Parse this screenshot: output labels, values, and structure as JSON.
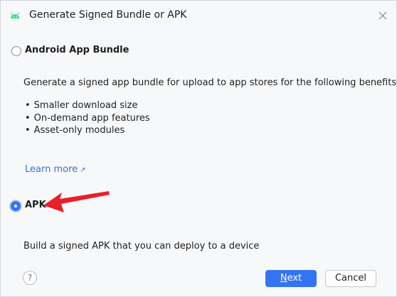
{
  "window": {
    "title": "Generate Signed Bundle or APK"
  },
  "options": {
    "bundle": {
      "label": "Android App Bundle",
      "selected": false,
      "description": "Generate a signed app bundle for upload to app stores for the following benefits:",
      "benefits": [
        "Smaller download size",
        "On-demand app features",
        "Asset-only modules"
      ],
      "learn_more": "Learn more"
    },
    "apk": {
      "label": "APK",
      "selected": true,
      "description": "Build a signed APK that you can deploy to a device"
    }
  },
  "footer": {
    "help_label": "?",
    "next_mnemonic": "N",
    "next_rest": "ext",
    "cancel_label": "Cancel"
  },
  "colors": {
    "accent": "#3574f0",
    "link": "#3b6fd1",
    "annotation": "#e8202a",
    "android_green": "#3ddc84"
  },
  "icons": {
    "app": "android-icon",
    "close": "close-icon",
    "external": "external-link-icon",
    "annotation": "red-arrow-annotation"
  }
}
